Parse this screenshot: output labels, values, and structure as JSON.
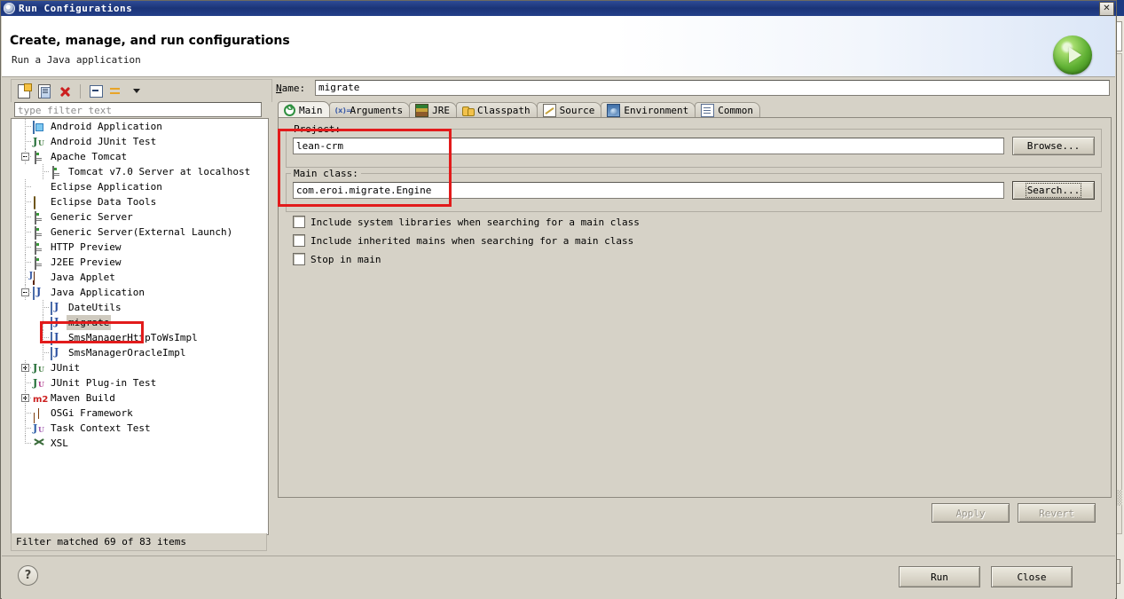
{
  "window": {
    "title": "Run Configurations",
    "title_icon": "gear-icon",
    "close_label": "✕"
  },
  "header": {
    "title": "Create, manage, and run configurations",
    "subtitle": "Run a Java application",
    "run_icon": "green-play-circle-icon"
  },
  "left_panel": {
    "toolbar": [
      {
        "name": "new-configuration-icon",
        "label": ""
      },
      {
        "name": "duplicate-configuration-icon",
        "label": ""
      },
      {
        "name": "delete-configuration-icon",
        "label": ""
      },
      {
        "name": "collapse-all-icon",
        "label": ""
      },
      {
        "name": "filter-icon",
        "label": ""
      },
      {
        "name": "chevron-down-icon",
        "label": ""
      }
    ],
    "filter": {
      "placeholder": "type filter text",
      "value": ""
    },
    "status": "Filter matched 69 of 83 items",
    "tree": [
      {
        "label": "Android Application",
        "indent": 1,
        "icon": "android",
        "expander": "",
        "selected": false
      },
      {
        "label": "Android JUnit Test",
        "indent": 1,
        "icon": "junit",
        "expander": "",
        "selected": false
      },
      {
        "label": "Apache Tomcat",
        "indent": 1,
        "icon": "server",
        "expander": "minus",
        "selected": false
      },
      {
        "label": "Tomcat v7.0 Server at localhost",
        "indent": 2,
        "icon": "server",
        "expander": "",
        "selected": false
      },
      {
        "label": "Eclipse Application",
        "indent": 1,
        "icon": "eclipse",
        "expander": "",
        "selected": false
      },
      {
        "label": "Eclipse Data Tools",
        "indent": 1,
        "icon": "db",
        "expander": "",
        "selected": false
      },
      {
        "label": "Generic Server",
        "indent": 1,
        "icon": "server",
        "expander": "",
        "selected": false
      },
      {
        "label": "Generic Server(External Launch)",
        "indent": 1,
        "icon": "server",
        "expander": "",
        "selected": false
      },
      {
        "label": "HTTP Preview",
        "indent": 1,
        "icon": "server",
        "expander": "",
        "selected": false
      },
      {
        "label": "J2EE Preview",
        "indent": 1,
        "icon": "server",
        "expander": "",
        "selected": false
      },
      {
        "label": "Java Applet",
        "indent": 1,
        "icon": "applet",
        "expander": "",
        "selected": false
      },
      {
        "label": "Java Application",
        "indent": 1,
        "icon": "javaapp",
        "expander": "minus",
        "selected": false
      },
      {
        "label": "DateUtils",
        "indent": 2,
        "icon": "javaapp",
        "expander": "",
        "selected": false
      },
      {
        "label": "migrate",
        "indent": 2,
        "icon": "javaapp",
        "expander": "",
        "selected": true
      },
      {
        "label": "SmsManagerHttpToWsImpl",
        "indent": 2,
        "icon": "javaapp",
        "expander": "",
        "selected": false
      },
      {
        "label": "SmsManagerOracleImpl",
        "indent": 2,
        "icon": "javaapp",
        "expander": "",
        "selected": false
      },
      {
        "label": "JUnit",
        "indent": 1,
        "icon": "junit",
        "expander": "plus",
        "selected": false
      },
      {
        "label": "JUnit Plug-in Test",
        "indent": 1,
        "icon": "jplug",
        "expander": "",
        "selected": false
      },
      {
        "label": "Maven Build",
        "indent": 1,
        "icon": "m2",
        "expander": "plus",
        "selected": false
      },
      {
        "label": "OSGi Framework",
        "indent": 1,
        "icon": "osgi",
        "expander": "",
        "selected": false
      },
      {
        "label": "Task Context Test",
        "indent": 1,
        "icon": "task",
        "expander": "",
        "selected": false
      },
      {
        "label": "XSL",
        "indent": 1,
        "icon": "xsl",
        "expander": "",
        "selected": false
      }
    ]
  },
  "right_panel": {
    "name_label": "Name:",
    "name_value": "migrate",
    "tabs": [
      {
        "label": "Main",
        "icon": "main-icon",
        "active": true
      },
      {
        "label": "Arguments",
        "icon": "arguments-icon",
        "active": false
      },
      {
        "label": "JRE",
        "icon": "jre-icon",
        "active": false
      },
      {
        "label": "Classpath",
        "icon": "classpath-icon",
        "active": false
      },
      {
        "label": "Source",
        "icon": "source-icon",
        "active": false
      },
      {
        "label": "Environment",
        "icon": "environment-icon",
        "active": false
      },
      {
        "label": "Common",
        "icon": "common-icon",
        "active": false
      }
    ],
    "main_tab": {
      "project_group_title": "Project:",
      "project_value": "lean-crm",
      "browse_button": "Browse...",
      "mainclass_group_title": "Main class:",
      "mainclass_value": "com.eroi.migrate.Engine",
      "search_button": "Search...",
      "checkboxes": [
        {
          "label": "Include system libraries when searching for a main class",
          "checked": false
        },
        {
          "label": "Include inherited mains when searching for a main class",
          "checked": false
        },
        {
          "label": "Stop in main",
          "checked": false
        }
      ]
    },
    "apply_button": "Apply",
    "revert_button": "Revert",
    "apply_enabled": false,
    "revert_enabled": false
  },
  "footer": {
    "help_label": "?",
    "run_button": "Run",
    "close_button": "Close"
  },
  "annotations": {
    "color": "#e21b1b",
    "regions": [
      "migrate-tree-item",
      "project-and-mainclass-fields"
    ]
  }
}
